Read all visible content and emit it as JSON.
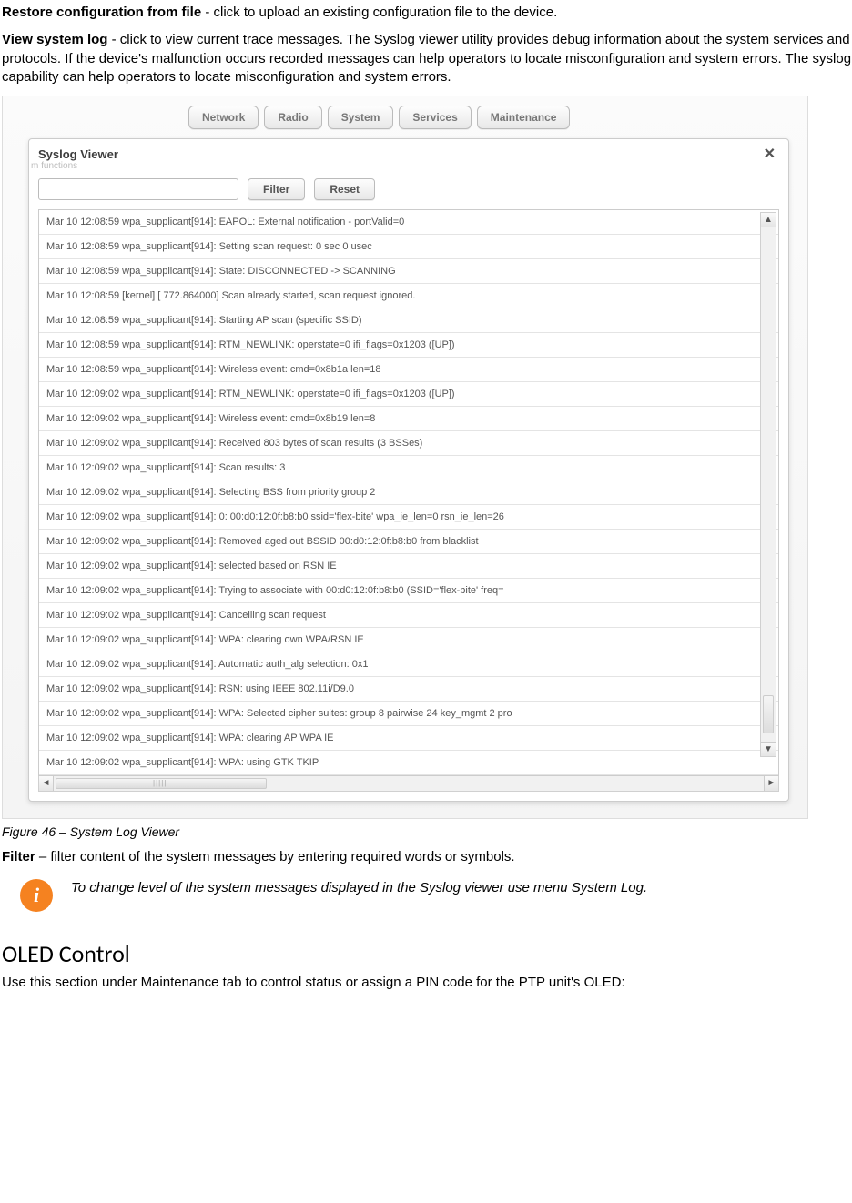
{
  "intro": {
    "restore_bold": "Restore configuration from file",
    "restore_text": " - click to upload an existing configuration file to the device.",
    "viewlog_bold": "View system log",
    "viewlog_text": " - click to view current trace messages. The Syslog viewer utility provides debug information about the system services and protocols. If the device's malfunction occurs recorded messages can help operators to locate misconfiguration and system errors. The syslog capability can help operators to locate misconfiguration and system errors."
  },
  "tabs": [
    "Network",
    "Radio",
    "System",
    "Services",
    "Maintenance"
  ],
  "dialog": {
    "title": "Syslog Viewer",
    "functions_hint": "m functions",
    "filter_btn": "Filter",
    "reset_btn": "Reset",
    "filter_placeholder": ""
  },
  "log_lines": [
    "Mar 10 12:08:59 wpa_supplicant[914]: EAPOL: External notification - portValid=0",
    "Mar 10 12:08:59 wpa_supplicant[914]: Setting scan request: 0 sec 0 usec",
    "Mar 10 12:08:59 wpa_supplicant[914]: State: DISCONNECTED -> SCANNING",
    "Mar 10 12:08:59 [kernel] [  772.864000] Scan already started, scan request ignored.",
    "Mar 10 12:08:59 wpa_supplicant[914]: Starting AP scan (specific SSID)",
    "Mar 10 12:08:59 wpa_supplicant[914]: RTM_NEWLINK: operstate=0 ifi_flags=0x1203 ([UP])",
    "Mar 10 12:08:59 wpa_supplicant[914]: Wireless event: cmd=0x8b1a len=18",
    "Mar 10 12:09:02 wpa_supplicant[914]: RTM_NEWLINK: operstate=0 ifi_flags=0x1203 ([UP])",
    "Mar 10 12:09:02 wpa_supplicant[914]: Wireless event: cmd=0x8b19 len=8",
    "Mar 10 12:09:02 wpa_supplicant[914]: Received 803 bytes of scan results (3 BSSes)",
    "Mar 10 12:09:02 wpa_supplicant[914]: Scan results: 3",
    "Mar 10 12:09:02 wpa_supplicant[914]: Selecting BSS from priority group 2",
    "Mar 10 12:09:02 wpa_supplicant[914]: 0: 00:d0:12:0f:b8:b0 ssid='flex-bite' wpa_ie_len=0 rsn_ie_len=26",
    "Mar 10 12:09:02 wpa_supplicant[914]: Removed aged out BSSID 00:d0:12:0f:b8:b0 from blacklist",
    "Mar 10 12:09:02 wpa_supplicant[914]:    selected based on RSN IE",
    "Mar 10 12:09:02 wpa_supplicant[914]: Trying to associate with 00:d0:12:0f:b8:b0 (SSID='flex-bite' freq=",
    "Mar 10 12:09:02 wpa_supplicant[914]: Cancelling scan request",
    "Mar 10 12:09:02 wpa_supplicant[914]: WPA: clearing own WPA/RSN IE",
    "Mar 10 12:09:02 wpa_supplicant[914]: Automatic auth_alg selection: 0x1",
    "Mar 10 12:09:02 wpa_supplicant[914]: RSN: using IEEE 802.11i/D9.0",
    "Mar 10 12:09:02 wpa_supplicant[914]: WPA: Selected cipher suites: group 8 pairwise 24 key_mgmt 2 pro",
    "Mar 10 12:09:02 wpa_supplicant[914]: WPA: clearing AP WPA IE",
    "Mar 10 12:09:02 wpa_supplicant[914]: WPA: using GTK TKIP"
  ],
  "caption": "Figure 46 – System Log Viewer",
  "filter_para_bold": "Filter",
  "filter_para_text": " – filter content of the system messages by entering required words or symbols.",
  "info_note": "To change level of the system messages displayed in the Syslog viewer use menu System Log.",
  "section_heading": "OLED Control",
  "section_text": "Use this section under Maintenance tab to control status or assign a PIN code for the PTP unit's OLED:"
}
